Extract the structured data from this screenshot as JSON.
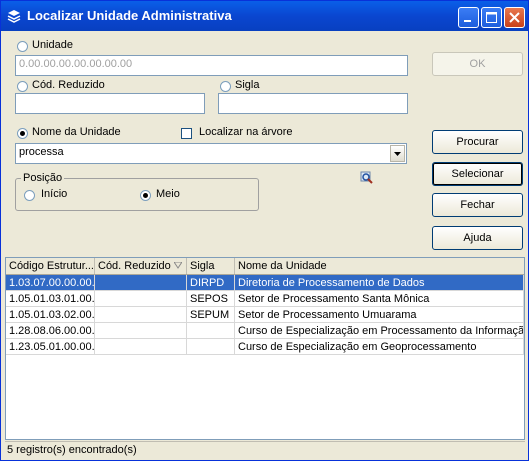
{
  "window": {
    "title": "Localizar Unidade Administrativa"
  },
  "unidade": {
    "label": "Unidade",
    "value": "0.00.00.00.00.00.00.00"
  },
  "cod_reduzido": {
    "label": "Cód. Reduzido",
    "value": ""
  },
  "sigla": {
    "label": "Sigla",
    "value": ""
  },
  "nome": {
    "label": "Nome da Unidade",
    "value": "processa"
  },
  "localizar_arvore": {
    "label": "Localizar na árvore",
    "checked": false
  },
  "posicao": {
    "title": "Posição",
    "inicio": "Início",
    "meio": "Meio",
    "selected": "Meio"
  },
  "buttons": {
    "ok": "OK",
    "procurar": "Procurar",
    "selecionar": "Selecionar",
    "fechar": "Fechar",
    "ajuda": "Ajuda"
  },
  "grid": {
    "columns": [
      "Código Estrutur...",
      "Cód. Reduzido",
      "Sigla",
      "Nome da Unidade"
    ],
    "rows": [
      [
        "1.03.07.00.00.00.",
        "",
        "DIRPD",
        "Diretoria de Processamento de Dados"
      ],
      [
        "1.05.01.03.01.00.",
        "",
        "SEPOS",
        "Setor de Processamento Santa Mônica"
      ],
      [
        "1.05.01.03.02.00.",
        "",
        "SEPUM",
        "Setor de Processamento Umuarama"
      ],
      [
        "1.28.08.06.00.00.",
        "",
        "",
        "Curso de Especialização em Processamento da Informação"
      ],
      [
        "1.23.05.01.00.00.",
        "",
        "",
        "Curso de Especialização em Geoprocessamento"
      ]
    ],
    "selected_row": 0
  },
  "status": "5 registro(s) encontrado(s)"
}
